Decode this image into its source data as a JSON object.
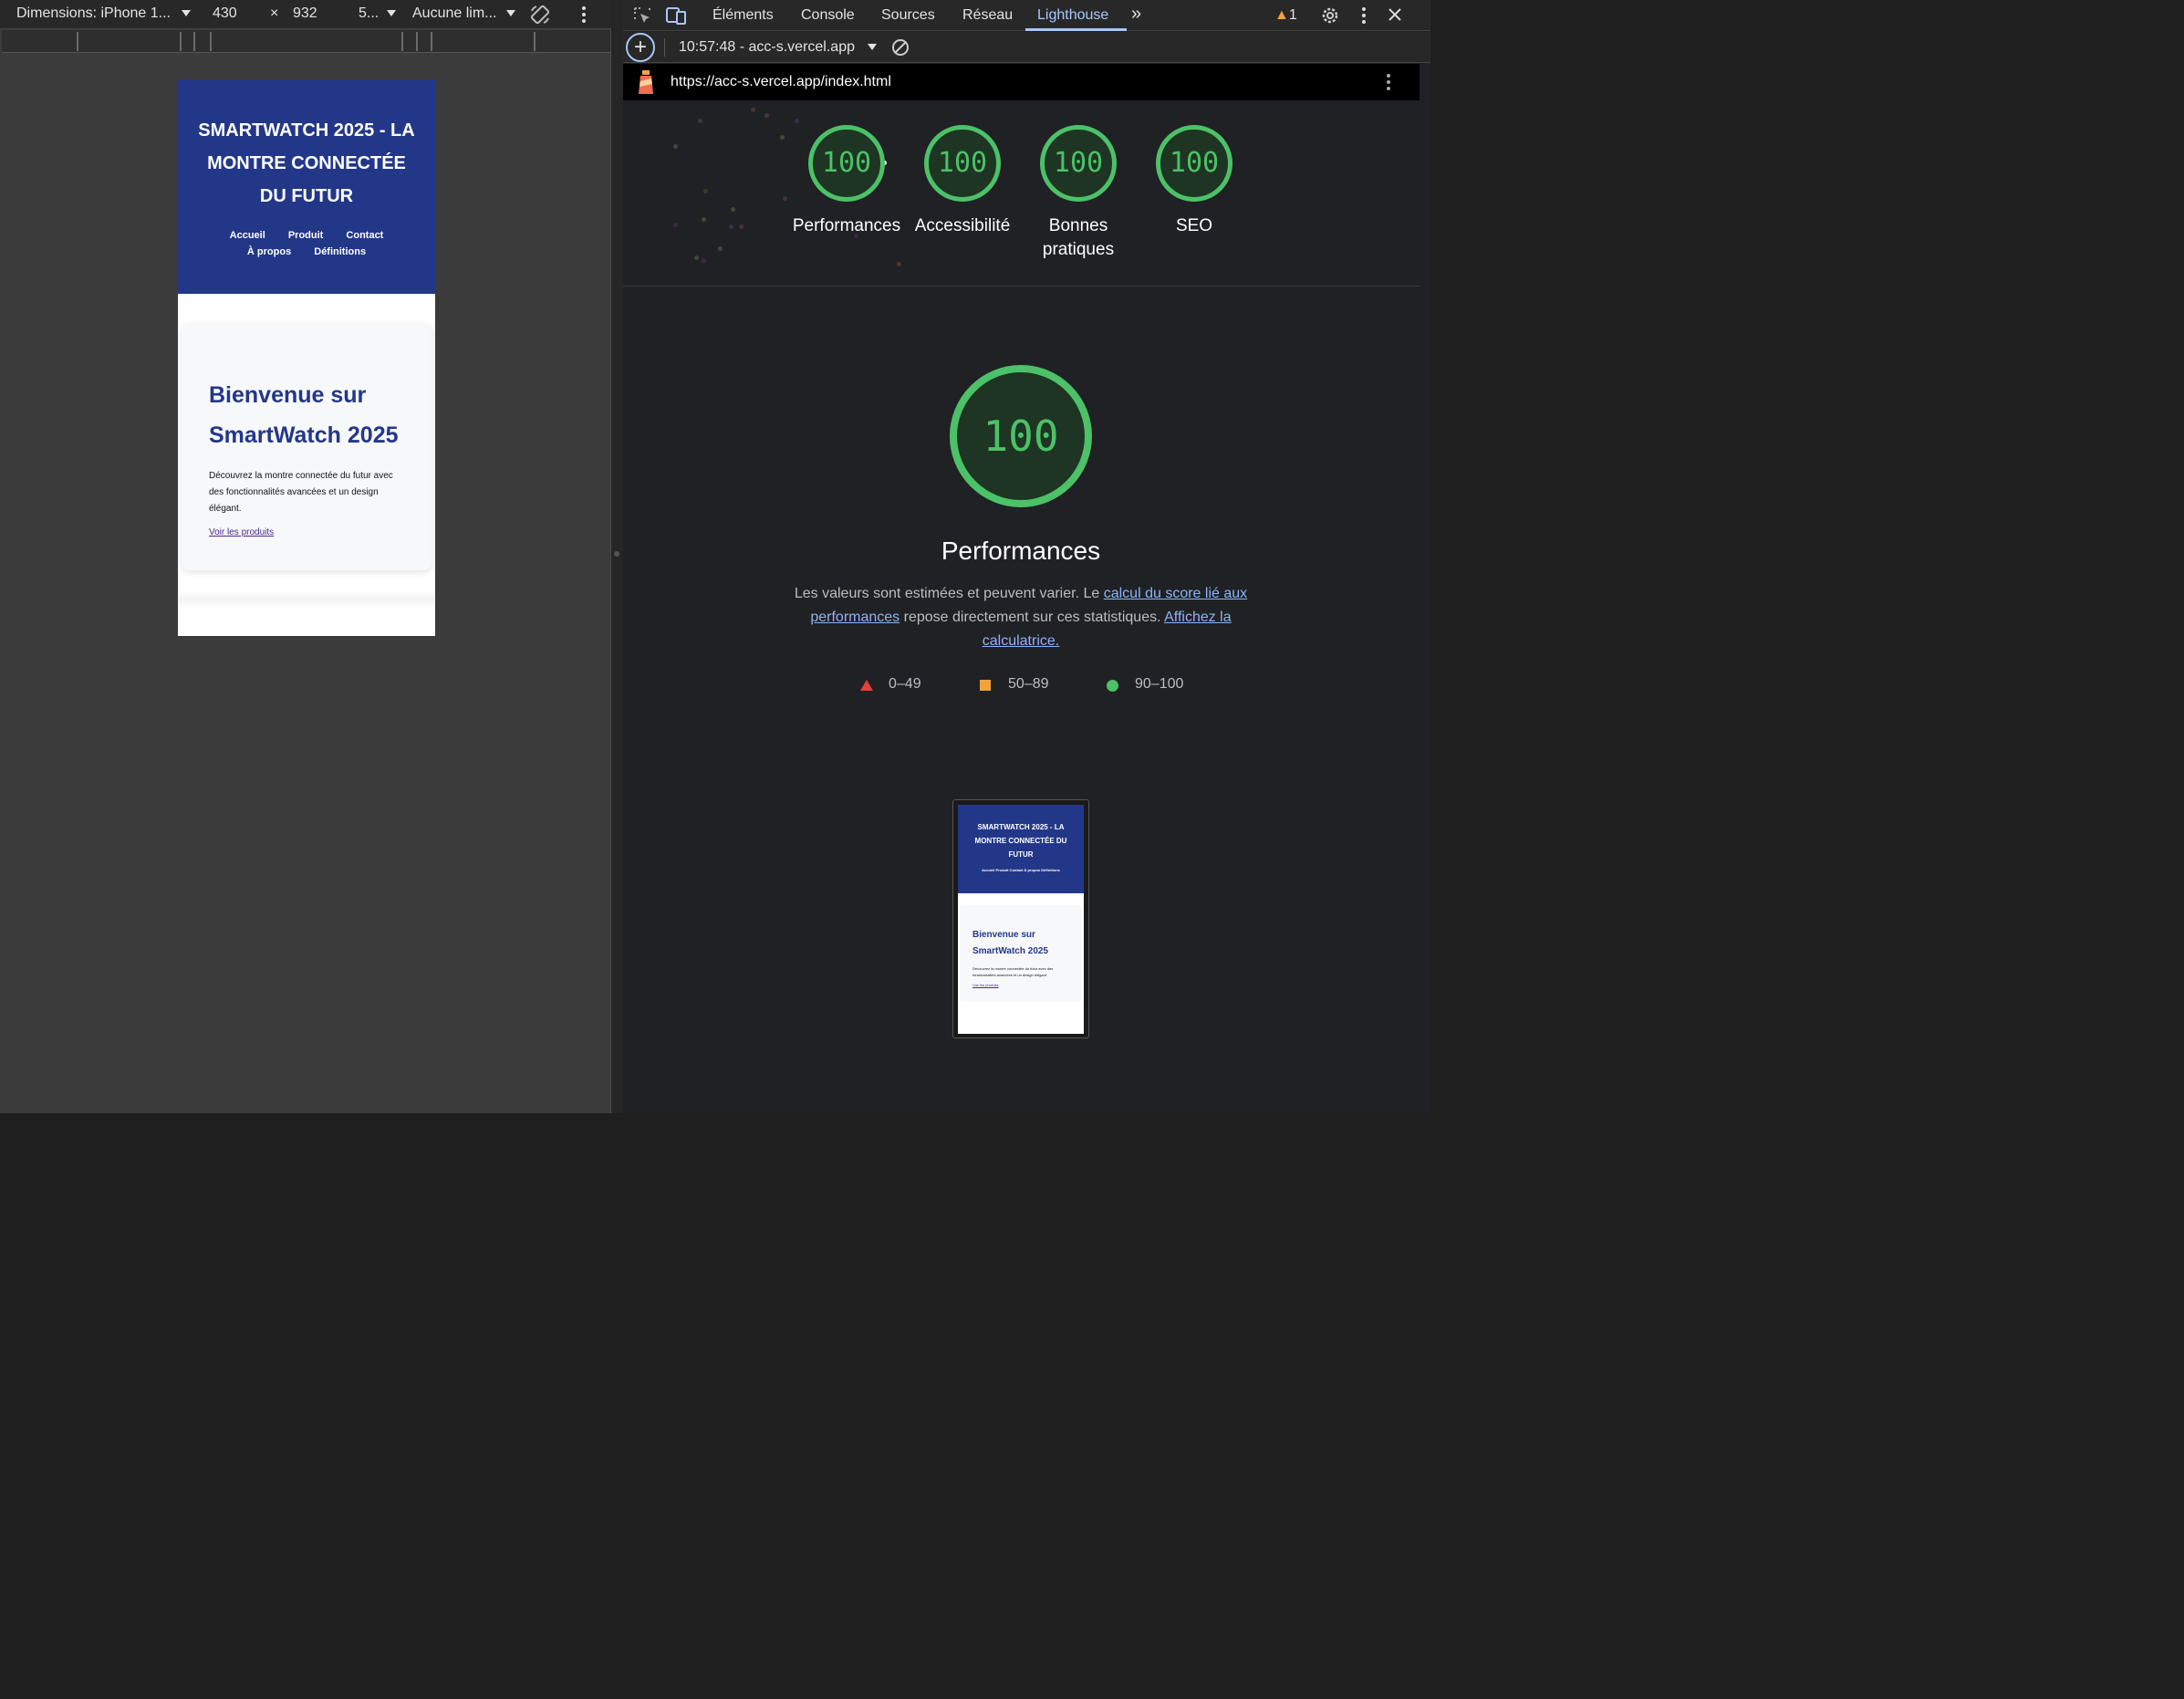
{
  "device_toolbar": {
    "dimensions_label": "Dimensions: iPhone 1...",
    "width_value": "430",
    "times": "×",
    "height_value": "932",
    "zoom_label": "5...",
    "throttle_label": "Aucune lim..."
  },
  "phone_page": {
    "title": "SMARTWATCH 2025 - LA MONTRE CONNECTÉE DU FUTUR",
    "nav_row1": [
      "Accueil",
      "Produit",
      "Contact"
    ],
    "nav_row2": [
      "À propos",
      "Définitions"
    ],
    "heading": "Bienvenue sur SmartWatch 2025",
    "paragraph": "Découvrez la montre connectée du futur avec des fonctionnalités avancées et un design élégant.",
    "link": "Voir les produits"
  },
  "devtools": {
    "tabs": [
      "Éléments",
      "Console",
      "Sources",
      "Réseau",
      "Lighthouse"
    ],
    "active_tab": "Lighthouse",
    "more_tabs": "»",
    "warning_count": "1",
    "run_label": "10:57:48 - acc-s.vercel.app",
    "url": "https://acc-s.vercel.app/index.html"
  },
  "lighthouse": {
    "scores": [
      {
        "label": "Performances",
        "value": 100
      },
      {
        "label": "Accessibilité",
        "value": 100
      },
      {
        "label": "Bonnes pratiques",
        "value": 100
      },
      {
        "label": "SEO",
        "value": 100
      }
    ],
    "main_score": "100",
    "main_title": "Performances",
    "desc_part1": "Les valeurs sont estimées et peuvent varier. Le ",
    "desc_link1": "calcul du score lié aux performances",
    "desc_part2": " repose directement sur ces statistiques. ",
    "desc_link2": "Affichez la calculatrice.",
    "legend": [
      {
        "range": "0–49",
        "shape": "triangle",
        "color": "#e5413b"
      },
      {
        "range": "50–89",
        "shape": "square",
        "color": "#f2a33a"
      },
      {
        "range": "90–100",
        "shape": "circle",
        "color": "#4cc168"
      }
    ],
    "accent_color": "#4cc168"
  },
  "thumbnail": {
    "title": "SMARTWATCH 2025 - LA MONTRE CONNECTÉE DU FUTUR",
    "nav": "Accueil    Produit    Contact    À propos    Définitions",
    "heading": "Bienvenue sur SmartWatch 2025",
    "paragraph": "Découvrez la montre connectée du futur avec des fonctionnalités avancées et un design élégant.",
    "link": "Voir les produits"
  }
}
